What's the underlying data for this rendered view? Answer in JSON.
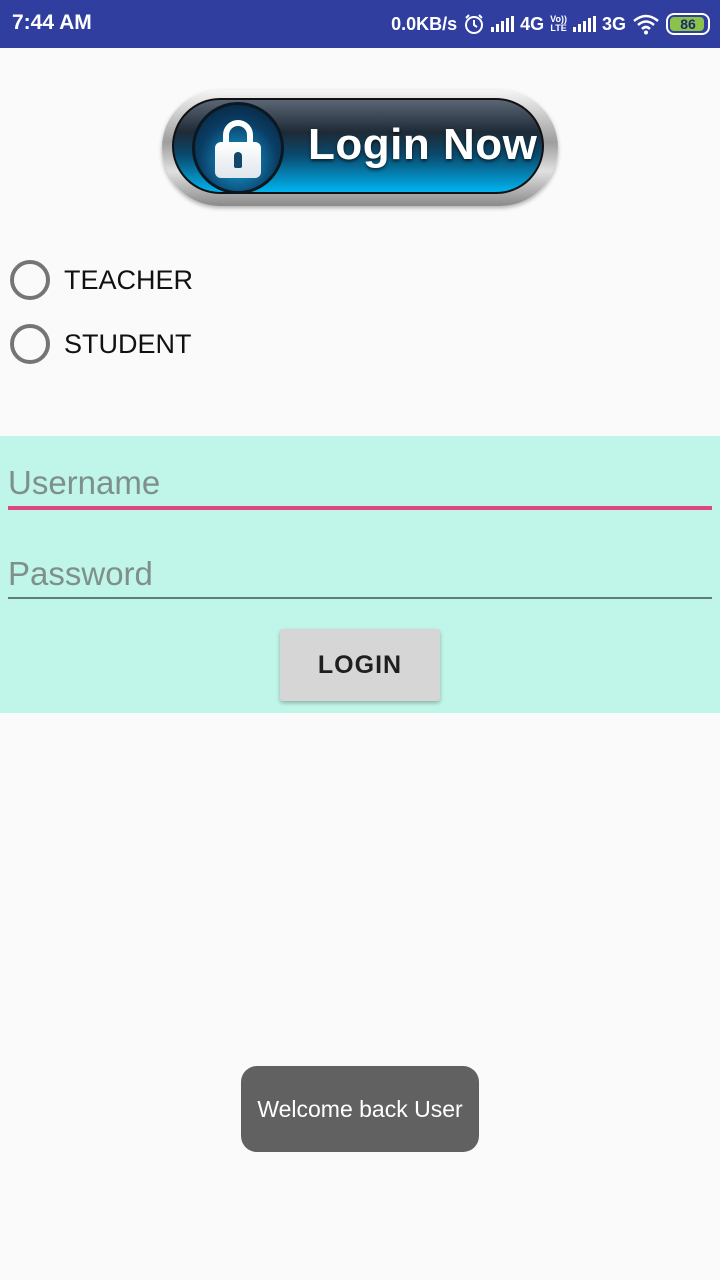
{
  "status_bar": {
    "time": "7:44 AM",
    "data_speed": "0.0KB/s",
    "network_1": "4G",
    "volte_top": "Vo))",
    "volte_bottom": "LTE",
    "network_2": "3G",
    "battery_level": "86",
    "icons": [
      "alarm-icon",
      "signal-icon",
      "signal-icon",
      "wifi-icon",
      "battery-icon"
    ]
  },
  "banner": {
    "text": "Login Now",
    "icon": "lock-icon"
  },
  "role_options": [
    {
      "label": "TEACHER",
      "selected": false
    },
    {
      "label": "STUDENT",
      "selected": false
    }
  ],
  "form": {
    "username_placeholder": "Username",
    "username_value": "",
    "password_placeholder": "Password",
    "password_value": "",
    "login_label": "LOGIN"
  },
  "toast": {
    "message": "Welcome back User"
  },
  "colors": {
    "status_bar": "#303f9f",
    "form_panel": "#c0f6e9",
    "focus_underline": "#e0457b",
    "toast": "#616161"
  }
}
